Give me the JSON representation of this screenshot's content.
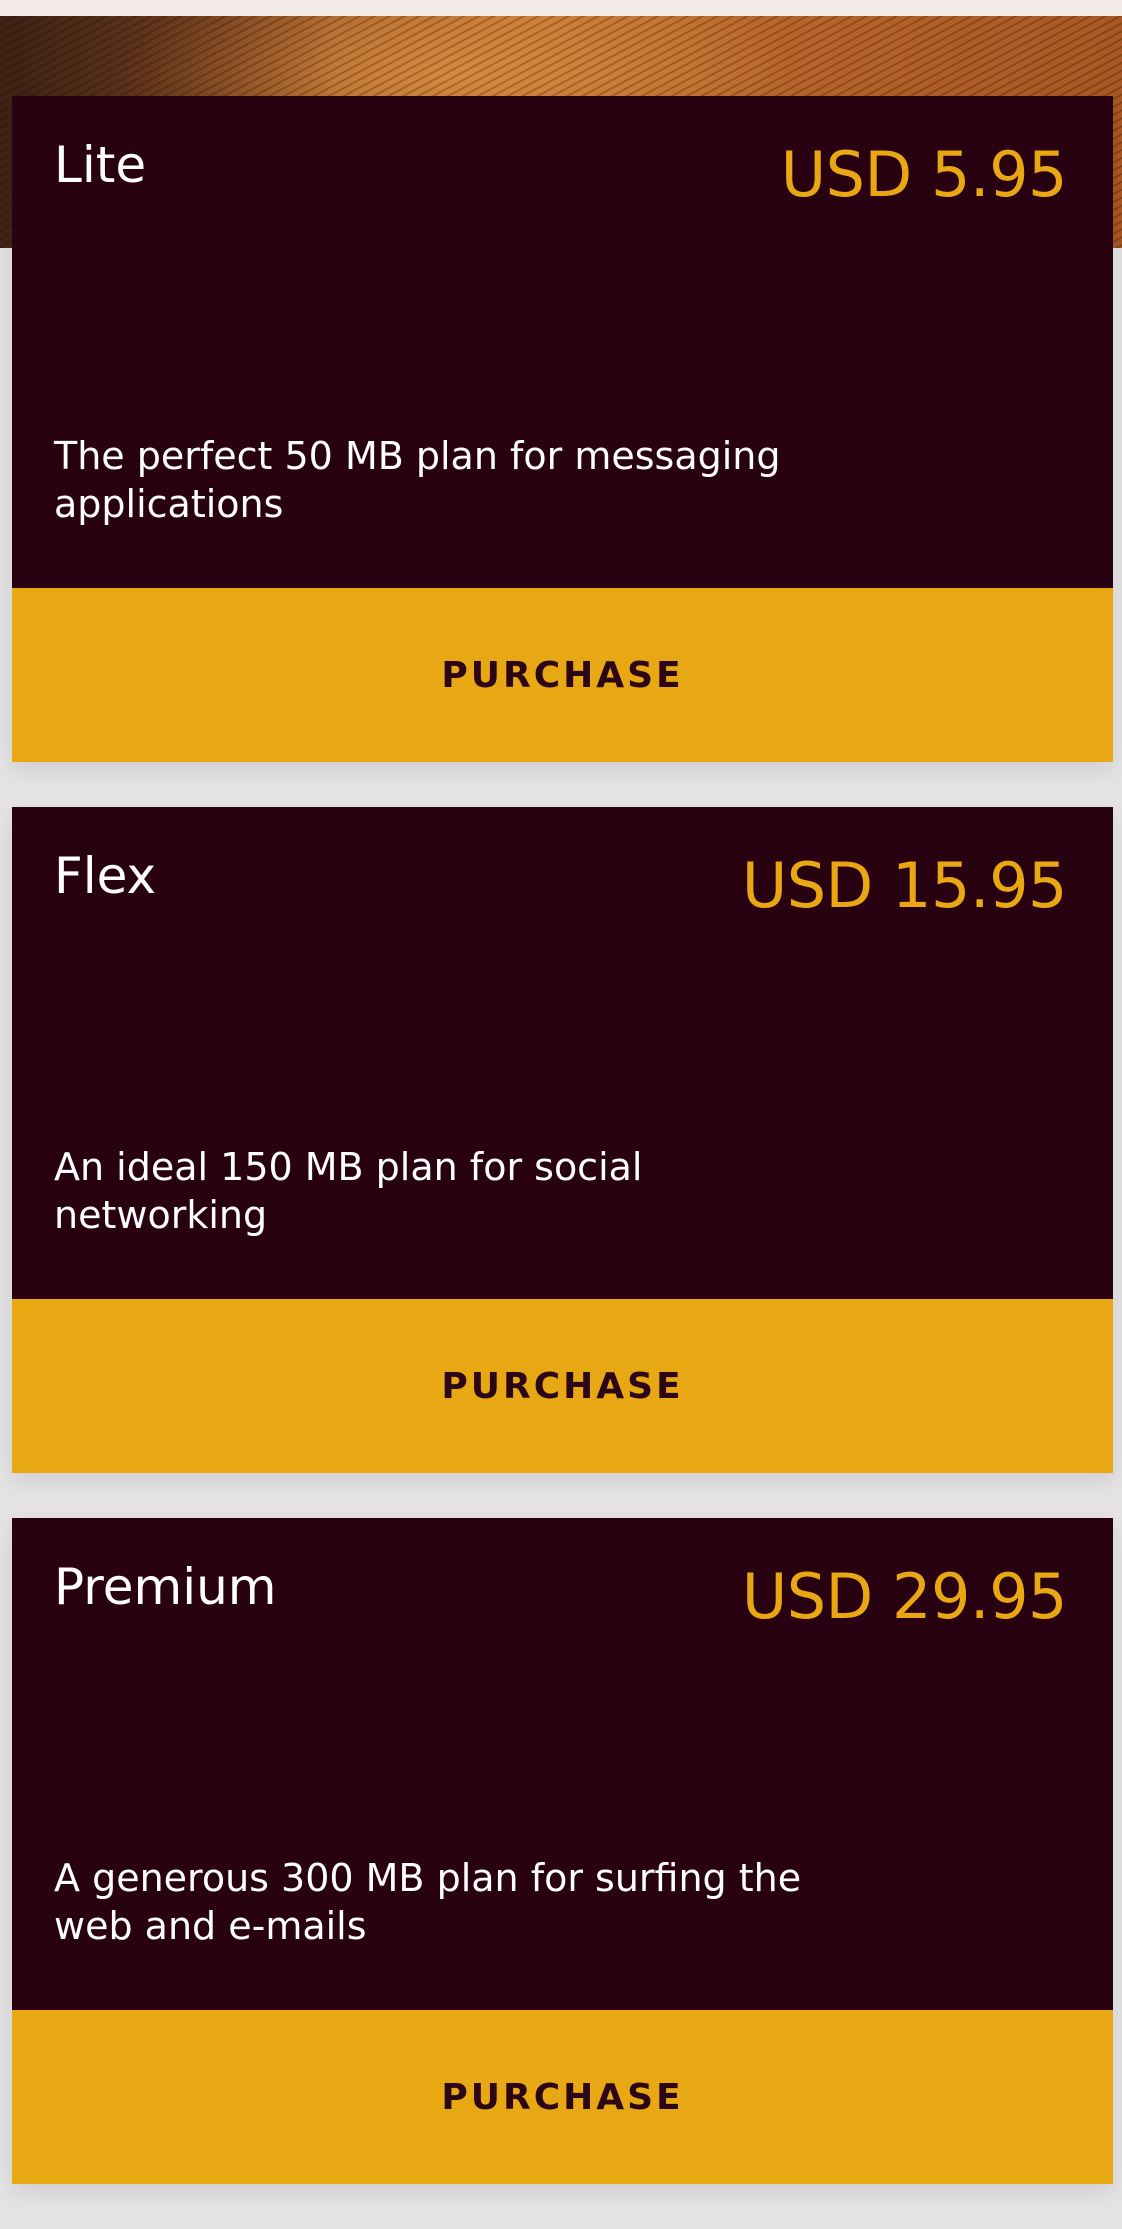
{
  "plans": [
    {
      "name": "Lite",
      "price": "USD 5.95",
      "description": "The perfect 50 MB plan for messaging applications",
      "button_label": "PURCHASE"
    },
    {
      "name": "Flex",
      "price": "USD 15.95",
      "description": "An ideal 150 MB plan for social networking",
      "button_label": "PURCHASE"
    },
    {
      "name": "Premium",
      "price": "USD 29.95",
      "description": "A generous 300 MB plan for surfing the web and e-mails",
      "button_label": "PURCHASE"
    }
  ],
  "colors": {
    "card_background": "#290212",
    "accent": "#e8a814",
    "page_background": "#e6e3e4"
  }
}
